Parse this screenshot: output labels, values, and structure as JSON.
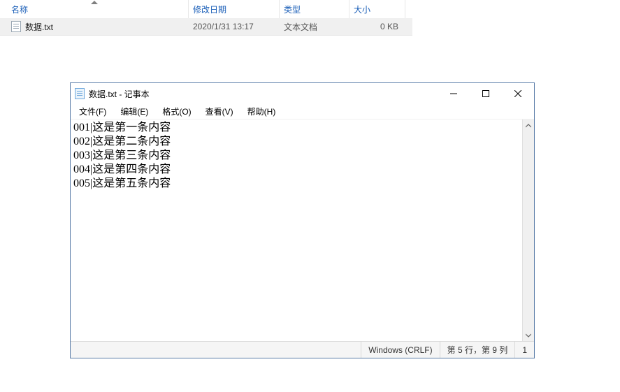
{
  "explorer": {
    "headers": {
      "name": "名称",
      "date": "修改日期",
      "type": "类型",
      "size": "大小"
    },
    "row": {
      "name": "数据.txt",
      "date": "2020/1/31 13:17",
      "type": "文本文档",
      "size": "0 KB"
    }
  },
  "notepad": {
    "title": "数据.txt - 记事本",
    "menu": {
      "file": "文件(F)",
      "edit": "编辑(E)",
      "format": "格式(O)",
      "view": "查看(V)",
      "help": "帮助(H)"
    },
    "lines": [
      "001|这是第一条内容",
      "002|这是第二条内容",
      "003|这是第三条内容",
      "004|这是第四条内容",
      "005|这是第五条内容"
    ],
    "status": {
      "encoding": "Windows (CRLF)",
      "cursor": "第 5 行，第 9 列",
      "zoom": "1"
    }
  }
}
